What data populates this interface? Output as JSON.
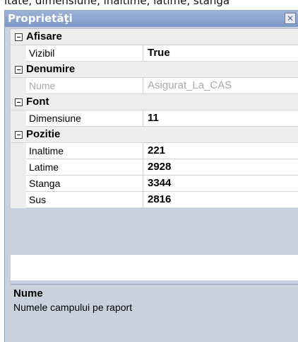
{
  "caption_text": "itate, dimensiune, inaltime, latime, stanga",
  "panel": {
    "title": "Proprietăţi",
    "close_icon": "close-icon"
  },
  "categories": [
    {
      "label": "Afisare",
      "properties": [
        {
          "name": "Vizibil",
          "value": "True",
          "disabled": false
        }
      ]
    },
    {
      "label": "Denumire",
      "properties": [
        {
          "name": "Nume",
          "value": "Asigurat_La_CAS",
          "disabled": true
        }
      ]
    },
    {
      "label": "Font",
      "properties": [
        {
          "name": "Dimensiune",
          "value": "11",
          "disabled": false
        }
      ]
    },
    {
      "label": "Pozitie",
      "properties": [
        {
          "name": "Inaltime",
          "value": "221",
          "disabled": false
        },
        {
          "name": "Latime",
          "value": "2928",
          "disabled": false
        },
        {
          "name": "Stanga",
          "value": "3344",
          "disabled": false
        },
        {
          "name": "Sus",
          "value": "2816",
          "disabled": false
        }
      ]
    }
  ],
  "description": {
    "title": "Nume",
    "text": "Numele campului pe raport"
  }
}
